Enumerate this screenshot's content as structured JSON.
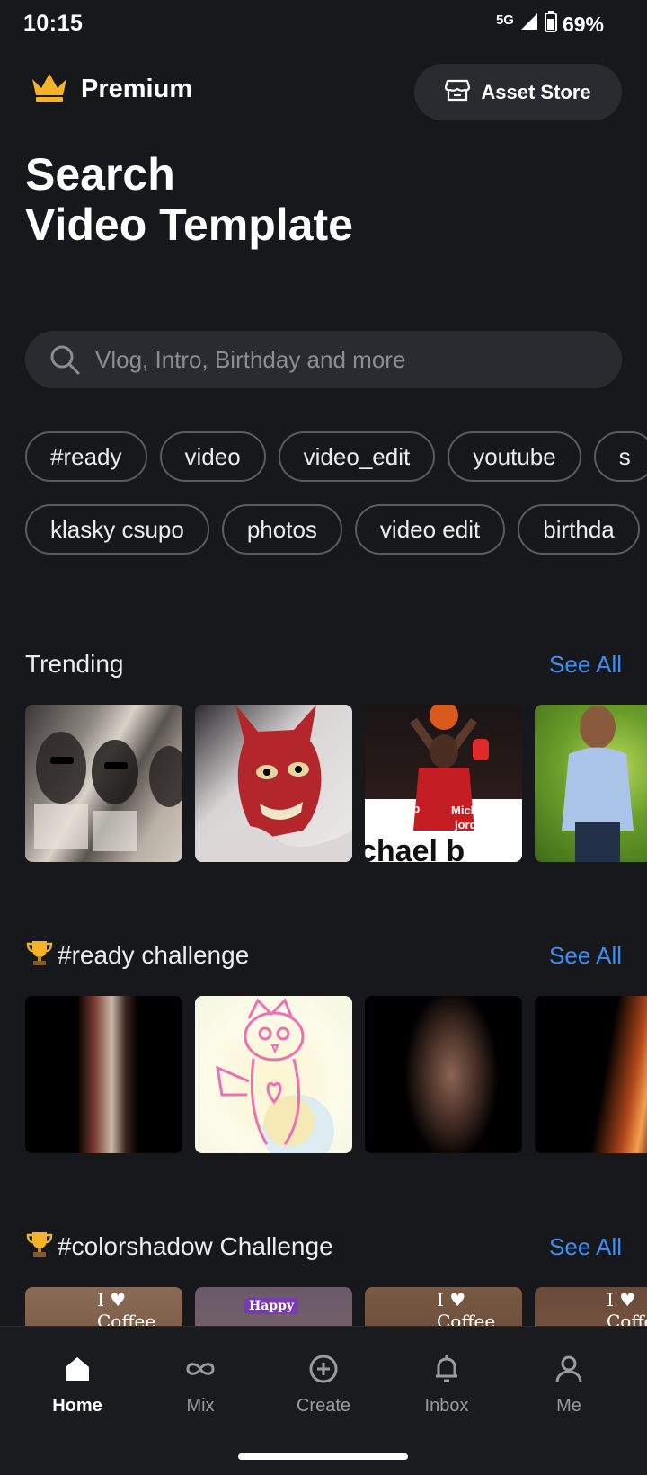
{
  "status_bar": {
    "time": "10:15",
    "network": "5G",
    "battery": "69%"
  },
  "header": {
    "premium_label": "Premium",
    "asset_store_label": "Asset Store"
  },
  "title": {
    "line1": "Search",
    "line2": "Video Template"
  },
  "search": {
    "placeholder": "Vlog, Intro, Birthday and more"
  },
  "tags_row1": [
    "#ready",
    "video",
    "video_edit",
    "youtube",
    "s"
  ],
  "tags_row2": [
    "klasky csupo",
    "photos",
    "video edit",
    "birthda"
  ],
  "sections": [
    {
      "title": "Trending",
      "trophy": false,
      "see_all": "See All"
    },
    {
      "title": "#ready challenge",
      "trophy": true,
      "see_all": "See All"
    },
    {
      "title": "#colorshadow Challenge",
      "trophy": true,
      "see_all": "See All"
    }
  ],
  "thumb_texts": {
    "jordan_line1": "Michael b",
    "jordan_line2": "jordan",
    "jordan_big": "chael b",
    "coffee": "I ♥ Coffee",
    "happy": "Happy"
  },
  "bottom_nav": [
    {
      "label": "Home",
      "icon": "home-icon",
      "active": true
    },
    {
      "label": "Mix",
      "icon": "infinity-icon",
      "active": false
    },
    {
      "label": "Create",
      "icon": "plus-circle-icon",
      "active": false
    },
    {
      "label": "Inbox",
      "icon": "bell-icon",
      "active": false
    },
    {
      "label": "Me",
      "icon": "person-icon",
      "active": false
    }
  ],
  "colors": {
    "background": "#17181c",
    "accent_link": "#3d8ef0",
    "crown": "#f5b325",
    "pill_bg": "#2a2b30"
  }
}
